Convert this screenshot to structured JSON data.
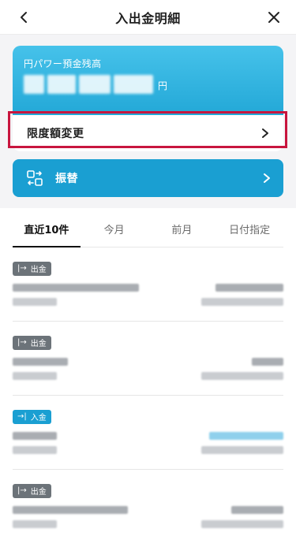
{
  "header": {
    "title": "入出金明細"
  },
  "balance": {
    "label": "円パワー預金残高",
    "unit": "円"
  },
  "limit": {
    "label": "限度額変更"
  },
  "transfer": {
    "label": "振替"
  },
  "tabs": [
    {
      "label": "直近10件",
      "active": true
    },
    {
      "label": "今月",
      "active": false
    },
    {
      "label": "前月",
      "active": false
    },
    {
      "label": "日付指定",
      "active": false
    }
  ],
  "transactions": [
    {
      "type": "出金",
      "direction": "out"
    },
    {
      "type": "出金",
      "direction": "out"
    },
    {
      "type": "入金",
      "direction": "in"
    },
    {
      "type": "出金",
      "direction": "out"
    }
  ],
  "colors": {
    "accent": "#1a9fd2",
    "highlight": "#c8153e",
    "badge_out": "#6c7379"
  }
}
